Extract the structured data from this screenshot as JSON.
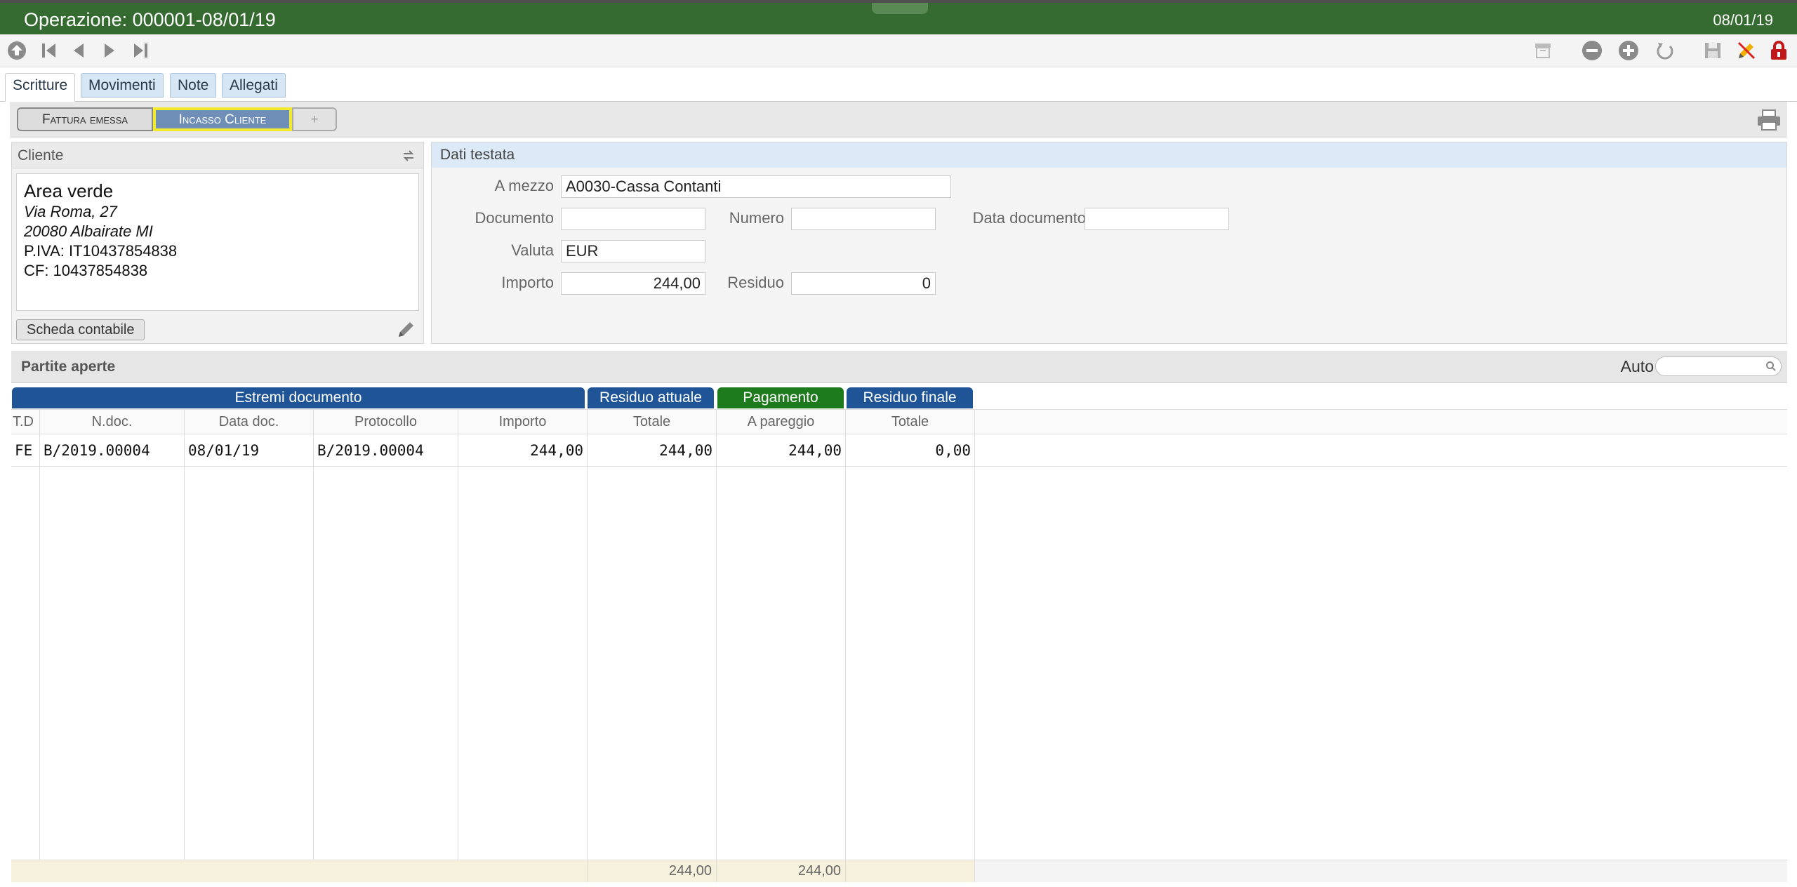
{
  "window": {
    "title": "Operazione: 000001-08/01/19",
    "date": "08/01/19"
  },
  "tabs": [
    "Scritture",
    "Movimenti",
    "Note",
    "Allegati"
  ],
  "subtabs": {
    "fattura": "Fattura emessa",
    "incasso": "Incasso Cliente",
    "add": "+"
  },
  "cliente": {
    "header": "Cliente",
    "name": "Area verde",
    "street": "Via Roma, 27",
    "city": "20080 Albairate  MI",
    "piva": "P.IVA: IT10437854838",
    "cf": "CF: 10437854838",
    "scheda_button": "Scheda contabile"
  },
  "testata": {
    "header": "Dati testata",
    "a_mezzo_label": "A mezzo",
    "a_mezzo_value": "A0030-Cassa Contanti",
    "documento_label": "Documento",
    "documento_value": "",
    "numero_label": "Numero",
    "numero_value": "",
    "data_documento_label": "Data documento",
    "data_documento_value": "",
    "valuta_label": "Valuta",
    "valuta_value": "EUR",
    "importo_label": "Importo",
    "importo_value": "244,00",
    "residuo_label": "Residuo",
    "residuo_value": "0"
  },
  "partite": {
    "title": "Partite aperte",
    "auto_label": "Auto",
    "groups": {
      "estremi": "Estremi documento",
      "residuo_attuale": "Residuo attuale",
      "pagamento": "Pagamento",
      "residuo_finale": "Residuo finale"
    },
    "columns": [
      "T.D",
      "N.doc.",
      "Data doc.",
      "Protocollo",
      "Importo",
      "Totale",
      "A pareggio",
      "Totale"
    ],
    "rows": [
      {
        "td": "FE",
        "ndoc": "B/2019.00004",
        "data": "08/01/19",
        "protocollo": "B/2019.00004",
        "importo": "244,00",
        "residuo_totale": "244,00",
        "a_pareggio": "244,00",
        "finale_totale": "0,00"
      }
    ],
    "totals": {
      "residuo_totale": "244,00",
      "a_pareggio": "244,00"
    }
  },
  "colors": {
    "title_bar": "#356b30",
    "group_blue": "#1f5597",
    "group_green": "#1d7a1d",
    "selected_subtab": "#6f8fb8",
    "highlight": "#f2ea2a"
  }
}
